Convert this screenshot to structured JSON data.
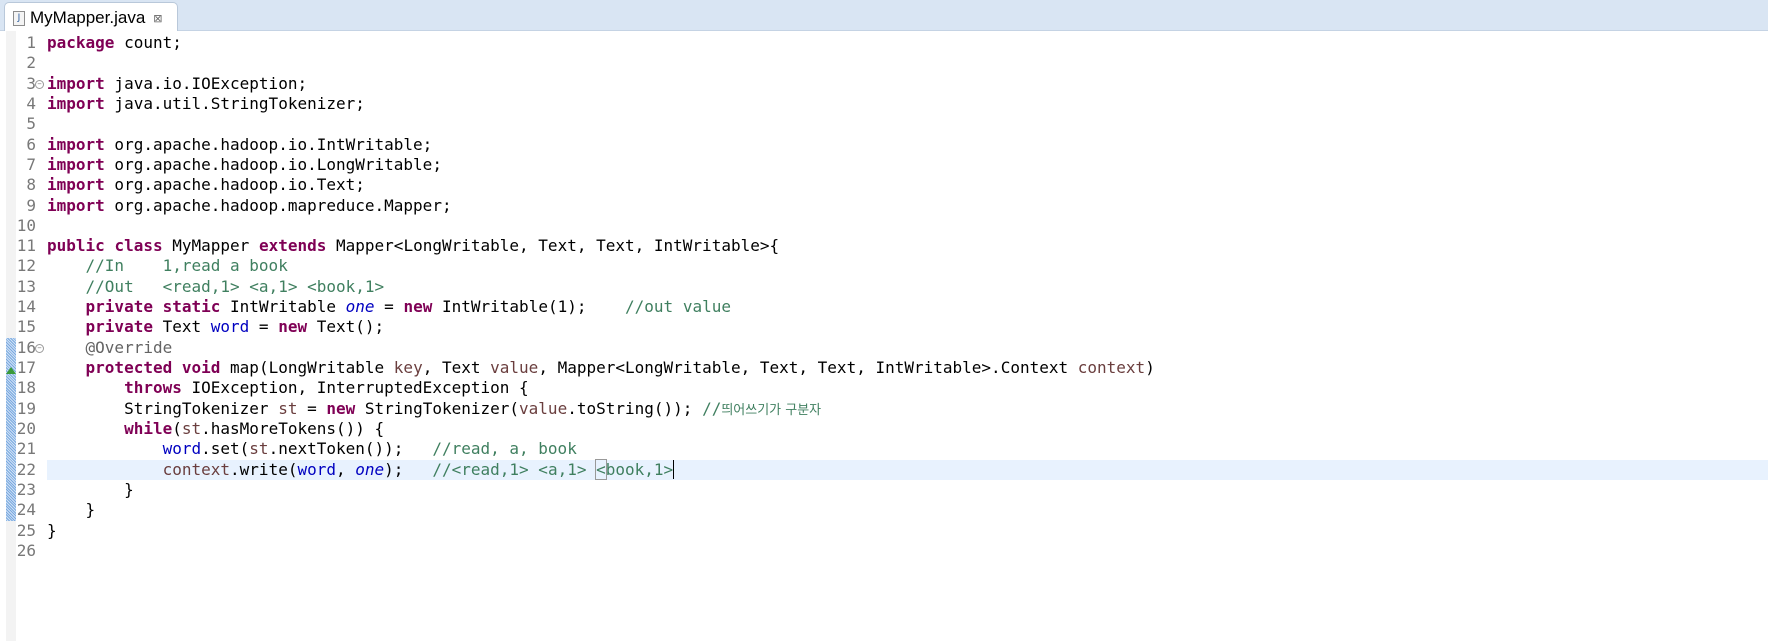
{
  "tab": {
    "label": "MyMapper.java",
    "icon": "java-file-icon",
    "close_icon": "close-icon"
  },
  "editor": {
    "current_line": 22,
    "lines": [
      [
        [
          "package",
          "kw"
        ],
        [
          " count;",
          ""
        ]
      ],
      [],
      [
        [
          "import",
          "kw"
        ],
        [
          " java.io.IOException;",
          ""
        ]
      ],
      [
        [
          "import",
          "kw"
        ],
        [
          " java.util.StringTokenizer;",
          ""
        ]
      ],
      [],
      [
        [
          "import",
          "kw"
        ],
        [
          " org.apache.hadoop.io.IntWritable;",
          ""
        ]
      ],
      [
        [
          "import",
          "kw"
        ],
        [
          " org.apache.hadoop.io.LongWritable;",
          ""
        ]
      ],
      [
        [
          "import",
          "kw"
        ],
        [
          " org.apache.hadoop.io.Text;",
          ""
        ]
      ],
      [
        [
          "import",
          "kw"
        ],
        [
          " org.apache.hadoop.mapreduce.Mapper;",
          ""
        ]
      ],
      [],
      [
        [
          "public",
          "kw"
        ],
        [
          " ",
          ""
        ],
        [
          "class",
          "kw"
        ],
        [
          " MyMapper ",
          ""
        ],
        [
          "extends",
          "kw"
        ],
        [
          " Mapper<LongWritable, Text, Text, IntWritable>{",
          ""
        ]
      ],
      [
        [
          "    ",
          ""
        ],
        [
          "//In    1,read a book",
          "cm"
        ]
      ],
      [
        [
          "    ",
          ""
        ],
        [
          "//Out   <read,1> <a,1> <book,1>",
          "cm"
        ]
      ],
      [
        [
          "    ",
          ""
        ],
        [
          "private",
          "kw"
        ],
        [
          " ",
          ""
        ],
        [
          "static",
          "kw"
        ],
        [
          " IntWritable ",
          ""
        ],
        [
          "one",
          "sfld"
        ],
        [
          " = ",
          ""
        ],
        [
          "new",
          "kw"
        ],
        [
          " IntWritable(1);    ",
          ""
        ],
        [
          "//out value",
          "cm"
        ]
      ],
      [
        [
          "    ",
          ""
        ],
        [
          "private",
          "kw"
        ],
        [
          " Text ",
          ""
        ],
        [
          "word",
          "fld"
        ],
        [
          " = ",
          ""
        ],
        [
          "new",
          "kw"
        ],
        [
          " Text();",
          ""
        ]
      ],
      [
        [
          "    ",
          ""
        ],
        [
          "@Override",
          "an"
        ]
      ],
      [
        [
          "    ",
          ""
        ],
        [
          "protected",
          "kw"
        ],
        [
          " ",
          ""
        ],
        [
          "void",
          "kw"
        ],
        [
          " map(LongWritable ",
          ""
        ],
        [
          "key",
          "lv"
        ],
        [
          ", Text ",
          ""
        ],
        [
          "value",
          "lv"
        ],
        [
          ", Mapper<LongWritable, Text, Text, IntWritable>.Context ",
          ""
        ],
        [
          "context",
          "lv"
        ],
        [
          ")",
          ""
        ]
      ],
      [
        [
          "        ",
          ""
        ],
        [
          "throws",
          "kw"
        ],
        [
          " IOException, InterruptedException {",
          ""
        ]
      ],
      [
        [
          "        StringTokenizer ",
          ""
        ],
        [
          "st",
          "lv"
        ],
        [
          " = ",
          ""
        ],
        [
          "new",
          "kw"
        ],
        [
          " StringTokenizer(",
          ""
        ],
        [
          "value",
          "lv"
        ],
        [
          ".toString()); ",
          ""
        ],
        [
          "//",
          "cm"
        ],
        [
          "띄어쓰기가 구분자",
          "cmk"
        ]
      ],
      [
        [
          "        ",
          ""
        ],
        [
          "while",
          "kw"
        ],
        [
          "(",
          ""
        ],
        [
          "st",
          "lv"
        ],
        [
          ".hasMoreTokens()) {",
          ""
        ]
      ],
      [
        [
          "            ",
          ""
        ],
        [
          "word",
          "fld"
        ],
        [
          ".set(",
          ""
        ],
        [
          "st",
          "lv"
        ],
        [
          ".nextToken());   ",
          ""
        ],
        [
          "//read, a, book",
          "cm"
        ]
      ],
      [
        [
          "            ",
          ""
        ],
        [
          "context",
          "lv"
        ],
        [
          ".write(",
          ""
        ],
        [
          "word",
          "fld"
        ],
        [
          ", ",
          ""
        ],
        [
          "one",
          "sfld"
        ],
        [
          ");   ",
          ""
        ],
        [
          "//<read,1> <a,1> ",
          "cm"
        ],
        [
          "<",
          "cm bracket"
        ],
        [
          "book,1>",
          "cm caret-after"
        ]
      ],
      [
        [
          "        }",
          ""
        ]
      ],
      [
        [
          "    }",
          ""
        ]
      ],
      [
        [
          "}",
          ""
        ]
      ],
      []
    ]
  }
}
